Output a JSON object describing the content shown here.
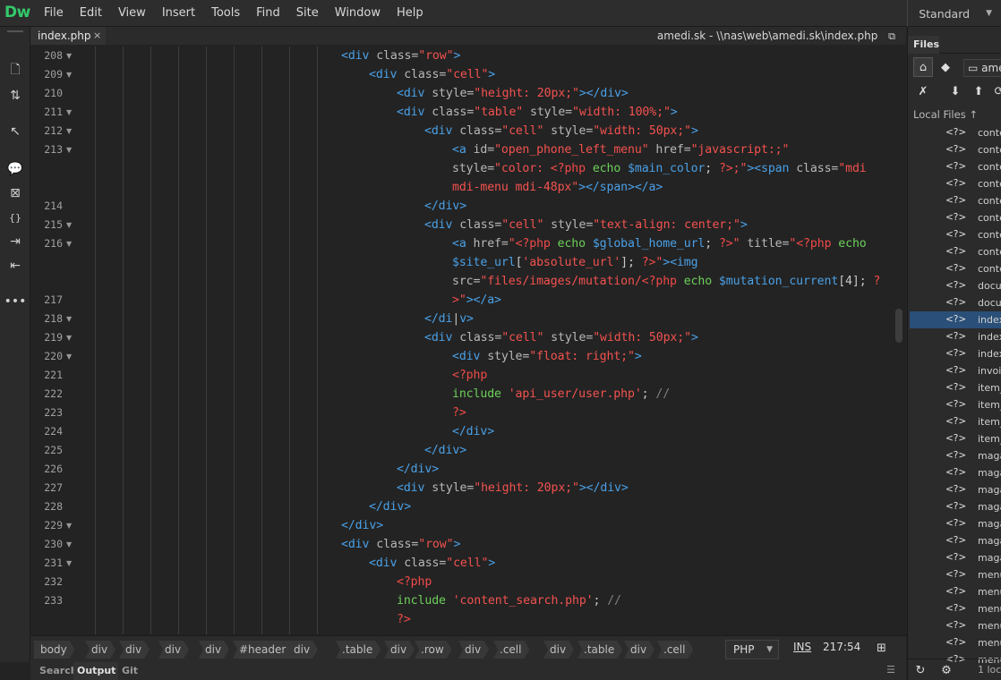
{
  "app": {
    "logo": "Dw",
    "workspace": "Standard"
  },
  "menu": [
    "File",
    "Edit",
    "View",
    "Insert",
    "Tools",
    "Find",
    "Site",
    "Window",
    "Help"
  ],
  "tab": {
    "filename": "index.php",
    "close_label": "×",
    "path": "amedi.sk - \\\\nas\\web\\amedi.sk\\index.php"
  },
  "toolbar_icons": [
    "file-icon",
    "arrows-icon",
    "inspect-icon",
    "comment-icon",
    "comment-remove-icon",
    "braces-icon",
    "indent-icon",
    "outdent-icon",
    "more-icon"
  ],
  "gutter": {
    "lines": [
      "208",
      "209",
      "210",
      "211",
      "212",
      "213",
      "",
      "",
      "214",
      "215",
      "216",
      "",
      "",
      "217",
      "218",
      "219",
      "220",
      "221",
      "222",
      "223",
      "224",
      "225",
      "226",
      "227",
      "228",
      "229",
      "230",
      "231",
      "232",
      "233"
    ],
    "folds": [
      true,
      true,
      false,
      true,
      true,
      true,
      false,
      false,
      false,
      true,
      true,
      false,
      false,
      false,
      true,
      true,
      true,
      false,
      false,
      false,
      false,
      false,
      false,
      false,
      false,
      true,
      true,
      true,
      false,
      false
    ]
  },
  "code": [
    [
      [
        "t",
        "<div "
      ],
      [
        "a",
        "class="
      ],
      [
        "s",
        "\"row\""
      ],
      [
        "t",
        ">"
      ]
    ],
    [
      [
        "t",
        "<div "
      ],
      [
        "a",
        "class="
      ],
      [
        "s",
        "\"cell\""
      ],
      [
        "t",
        ">"
      ]
    ],
    [
      [
        "t",
        "<div "
      ],
      [
        "a",
        "style="
      ],
      [
        "s",
        "\"height: 20px;\""
      ],
      [
        "t",
        "></div>"
      ]
    ],
    [
      [
        "t",
        "<div "
      ],
      [
        "a",
        "class="
      ],
      [
        "s",
        "\"table\""
      ],
      [
        "a",
        " style="
      ],
      [
        "s",
        "\"width: 100%;\""
      ],
      [
        "t",
        ">"
      ]
    ],
    [
      [
        "t",
        "<div "
      ],
      [
        "a",
        "class="
      ],
      [
        "s",
        "\"cell\""
      ],
      [
        "a",
        " style="
      ],
      [
        "s",
        "\"width: 50px;\""
      ],
      [
        "t",
        ">"
      ]
    ],
    [
      [
        "t",
        "<a "
      ],
      [
        "a",
        "id="
      ],
      [
        "s",
        "\"open_phone_left_menu\""
      ],
      [
        "a",
        " href="
      ],
      [
        "s",
        "\"javascript:;\""
      ]
    ],
    [
      [
        "a",
        "style="
      ],
      [
        "s",
        "\"color: "
      ],
      [
        "p",
        "<?php "
      ],
      [
        "k",
        "echo "
      ],
      [
        "v",
        "$main_color"
      ],
      [
        "o",
        "; "
      ],
      [
        "p",
        "?>"
      ],
      [
        "s",
        ";\""
      ],
      [
        "t",
        "><span "
      ],
      [
        "a",
        "class="
      ],
      [
        "s",
        "\"mdi"
      ]
    ],
    [
      [
        "s",
        "mdi-menu mdi-48px\""
      ],
      [
        "t",
        "></span></a>"
      ]
    ],
    [
      [
        "t",
        "</div>"
      ]
    ],
    [
      [
        "t",
        "<div "
      ],
      [
        "a",
        "class="
      ],
      [
        "s",
        "\"cell\""
      ],
      [
        "a",
        " style="
      ],
      [
        "s",
        "\"text-align: center;\""
      ],
      [
        "t",
        ">"
      ]
    ],
    [
      [
        "t",
        "<a "
      ],
      [
        "a",
        "href="
      ],
      [
        "s",
        "\""
      ],
      [
        "p",
        "<?php "
      ],
      [
        "k",
        "echo "
      ],
      [
        "v",
        "$global_home_url"
      ],
      [
        "o",
        "; "
      ],
      [
        "p",
        "?>"
      ],
      [
        "s",
        "\""
      ],
      [
        "a",
        " title="
      ],
      [
        "s",
        "\""
      ],
      [
        "p",
        "<?php "
      ],
      [
        "k",
        "echo"
      ]
    ],
    [
      [
        "v",
        "$site_url"
      ],
      [
        "o",
        "["
      ],
      [
        "s",
        "'absolute_url'"
      ],
      [
        "o",
        "]; "
      ],
      [
        "p",
        "?>"
      ],
      [
        "s",
        "\""
      ],
      [
        "t",
        "><img"
      ]
    ],
    [
      [
        "a",
        "src="
      ],
      [
        "s",
        "\"files/images/mutation/"
      ],
      [
        "p",
        "<?php "
      ],
      [
        "k",
        "echo "
      ],
      [
        "v",
        "$mutation_current"
      ],
      [
        "o",
        "[4]; "
      ],
      [
        "p",
        "?"
      ]
    ],
    [
      [
        "p",
        ">"
      ],
      [
        "s",
        "\""
      ],
      [
        "t",
        "></a>"
      ]
    ],
    [
      [
        "t",
        "</di"
      ],
      [
        "o",
        "|"
      ],
      [
        "t",
        "v>"
      ]
    ],
    [
      [
        "t",
        "<div "
      ],
      [
        "a",
        "class="
      ],
      [
        "s",
        "\"cell\""
      ],
      [
        "a",
        " style="
      ],
      [
        "s",
        "\"width: 50px;\""
      ],
      [
        "t",
        ">"
      ]
    ],
    [
      [
        "t",
        "<div "
      ],
      [
        "a",
        "style="
      ],
      [
        "s",
        "\"float: right;\""
      ],
      [
        "t",
        ">"
      ]
    ],
    [
      [
        "p",
        "<?php"
      ]
    ],
    [
      [
        "k",
        "include "
      ],
      [
        "s",
        "'api_user/user.php'"
      ],
      [
        "o",
        "; "
      ],
      [
        "c",
        "//"
      ]
    ],
    [
      [
        "p",
        "?>"
      ]
    ],
    [
      [
        "t",
        "</div>"
      ]
    ],
    [
      [
        "t",
        "</div>"
      ]
    ],
    [
      [
        "t",
        "</div>"
      ]
    ],
    [
      [
        "t",
        "<div "
      ],
      [
        "a",
        "style="
      ],
      [
        "s",
        "\"height: 20px;\""
      ],
      [
        "t",
        "></div>"
      ]
    ],
    [
      [
        "t",
        "</div>"
      ]
    ],
    [
      [
        "t",
        "</div>"
      ]
    ],
    [
      [
        "t",
        "<div "
      ],
      [
        "a",
        "class="
      ],
      [
        "s",
        "\"row\""
      ],
      [
        "t",
        ">"
      ]
    ],
    [
      [
        "t",
        "<div "
      ],
      [
        "a",
        "class="
      ],
      [
        "s",
        "\"cell\""
      ],
      [
        "t",
        ">"
      ]
    ],
    [
      [
        "p",
        "<?php"
      ]
    ],
    [
      [
        "k",
        "include "
      ],
      [
        "s",
        "'content_search.php'"
      ],
      [
        "o",
        "; "
      ],
      [
        "c",
        "//"
      ]
    ],
    [
      [
        "p",
        "?>"
      ]
    ]
  ],
  "code_indent": [
    0,
    1,
    2,
    2,
    3,
    4,
    4,
    4,
    3,
    3,
    4,
    4,
    4,
    4,
    3,
    3,
    4,
    4,
    4,
    4,
    4,
    3,
    2,
    2,
    1,
    0,
    0,
    1,
    2,
    2,
    2
  ],
  "breadcrumbs": [
    "body",
    "div",
    "div",
    "div",
    "div",
    "#header",
    "div",
    ".table",
    "div",
    ".row",
    "div",
    ".cell",
    "div",
    ".table",
    "div",
    ".cell"
  ],
  "status": {
    "language": "PHP",
    "ins": "INS",
    "cursor_pos": "217:54"
  },
  "bottom_tabs": [
    "Search",
    "Output",
    "Git"
  ],
  "files_panel": {
    "title": "Files",
    "site_name": "amedi",
    "local_files_label": "Local Files",
    "items": [
      "conte",
      "conte",
      "conte",
      "conte",
      "conte",
      "conte",
      "conte",
      "conte",
      "conte",
      "docun",
      "docun",
      "index",
      "index",
      "index",
      "invoic",
      "item_",
      "item_",
      "item_",
      "item_",
      "maga",
      "maga",
      "maga",
      "maga",
      "maga",
      "maga",
      "maga",
      "menu",
      "menu",
      "menu",
      "menu",
      "menu",
      "menu"
    ],
    "selected_index": 11,
    "footer_text": "1 loca"
  }
}
